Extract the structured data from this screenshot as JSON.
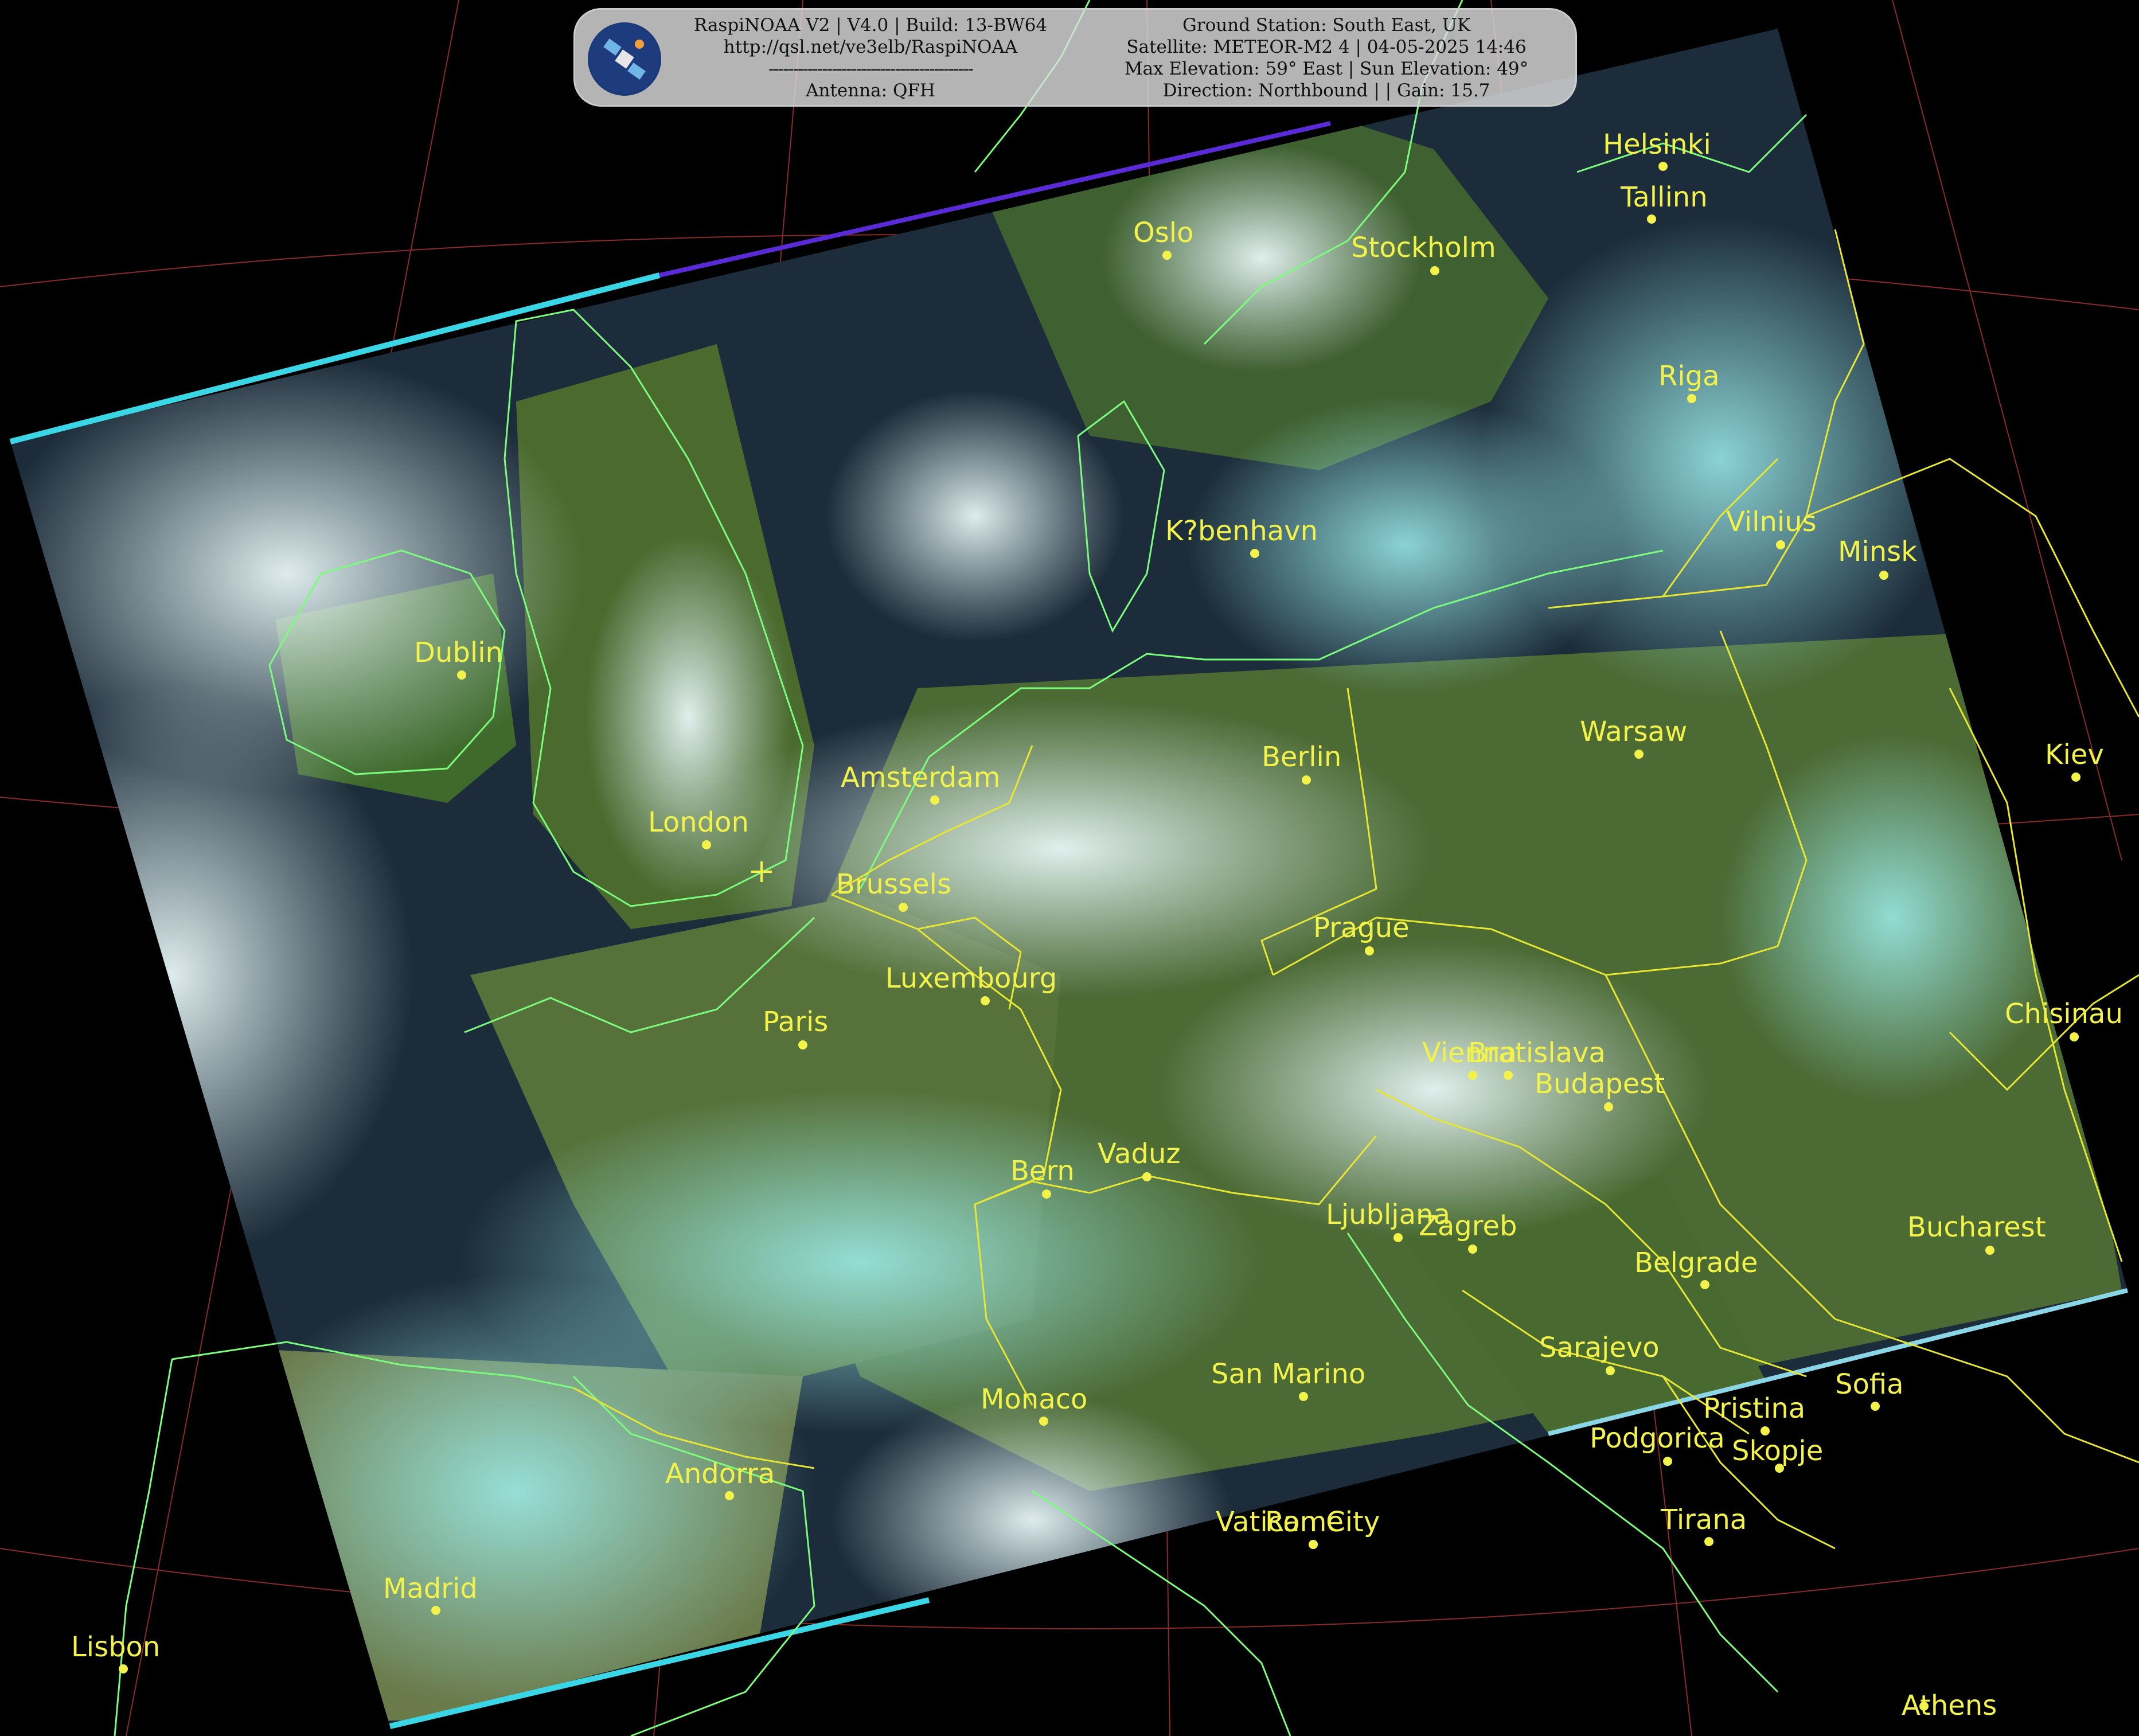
{
  "banner": {
    "left_lines": [
      "RaspiNOAA V2 | V4.0 | Build: 13-BW64",
      "http://qsl.net/ve3elb/RaspiNOAA",
      "------------------------------------------",
      "Antenna: QFH"
    ],
    "right_lines": [
      "Ground Station: South East, UK",
      "Satellite: METEOR-M2 4 | 04-05-2025 14:46",
      "Max Elevation: 59° East | Sun Elevation: 49°",
      "Direction: Northbound | | Gain: 15.7"
    ],
    "logo_icon": "satellite-icon"
  },
  "cities": [
    {
      "name": "Helsinki"
    },
    {
      "name": "Tallinn"
    },
    {
      "name": "Oslo"
    },
    {
      "name": "Stockholm"
    },
    {
      "name": "Riga"
    },
    {
      "name": "K?benhavn"
    },
    {
      "name": "Vilnius"
    },
    {
      "name": "Minsk"
    },
    {
      "name": "Dublin"
    },
    {
      "name": "Warsaw"
    },
    {
      "name": "Kiev"
    },
    {
      "name": "Berlin"
    },
    {
      "name": "Amsterdam"
    },
    {
      "name": "London"
    },
    {
      "name": "Brussels"
    },
    {
      "name": "Prague"
    },
    {
      "name": "Luxembourg"
    },
    {
      "name": "Paris"
    },
    {
      "name": "Chisinau"
    },
    {
      "name": "Vienna"
    },
    {
      "name": "Bratislava"
    },
    {
      "name": "Budapest"
    },
    {
      "name": "Bern"
    },
    {
      "name": "Vaduz"
    },
    {
      "name": "Ljubljana"
    },
    {
      "name": "Zagreb"
    },
    {
      "name": "Bucharest"
    },
    {
      "name": "Belgrade"
    },
    {
      "name": "Sarajevo"
    },
    {
      "name": "San Marino"
    },
    {
      "name": "Monaco"
    },
    {
      "name": "Sofia"
    },
    {
      "name": "Pristina"
    },
    {
      "name": "Podgorica"
    },
    {
      "name": "Skopje"
    },
    {
      "name": "Andorra"
    },
    {
      "name": "Tirana"
    },
    {
      "name": "Vatican City"
    },
    {
      "name": "Rome"
    },
    {
      "name": "Madrid"
    },
    {
      "name": "Lisbon"
    },
    {
      "name": "Athens"
    }
  ],
  "colors": {
    "label": "#f2f24a",
    "coastline": "#7CFC7C",
    "border": "#e6e633",
    "ocean": "#1a2a3a",
    "cloud": "#d8ecec",
    "land": "#4a6a2a"
  }
}
